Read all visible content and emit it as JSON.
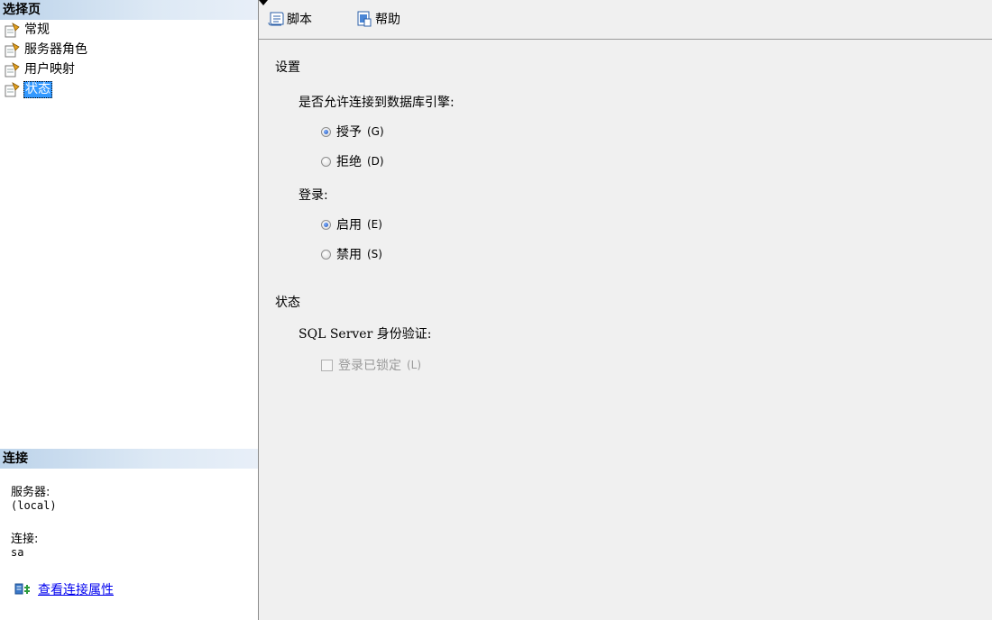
{
  "left_panel": {
    "pages_header": "选择页",
    "pages": [
      {
        "label": "常规",
        "icon": "page-settings-icon"
      },
      {
        "label": "服务器角色",
        "icon": "page-settings-icon"
      },
      {
        "label": "用户映射",
        "icon": "page-settings-icon"
      },
      {
        "label": "状态",
        "icon": "page-settings-icon",
        "selected": true
      }
    ],
    "connection_header": "连接",
    "server_label": "服务器:",
    "server_value": "(local)",
    "connection_label": "连接:",
    "connection_value": "sa",
    "view_props_link": "查看连接属性"
  },
  "toolbar": {
    "script_label": "脚本",
    "help_label": "帮助"
  },
  "settings": {
    "group_title": "设置",
    "allow_connect_label": "是否允许连接到数据库引擎:",
    "grant": {
      "text": "授予",
      "mnemonic": "(G)",
      "checked": true
    },
    "deny": {
      "text": "拒绝",
      "mnemonic": "(D)",
      "checked": false
    },
    "login_label": "登录:",
    "enable": {
      "text": "启用",
      "mnemonic": "(E)",
      "checked": true
    },
    "disable": {
      "text": "禁用",
      "mnemonic": "(S)",
      "checked": false
    }
  },
  "status": {
    "group_title": "状态",
    "auth_label": "SQL Server 身份验证:",
    "locked": {
      "text": "登录已锁定",
      "mnemonic": "(L)",
      "checked": false,
      "enabled": false
    }
  },
  "colors": {
    "header_gradient_start": "#bcd3ea",
    "selection": "#3399ff",
    "link": "#0000ee",
    "disabled_text": "#9a9a9a"
  }
}
